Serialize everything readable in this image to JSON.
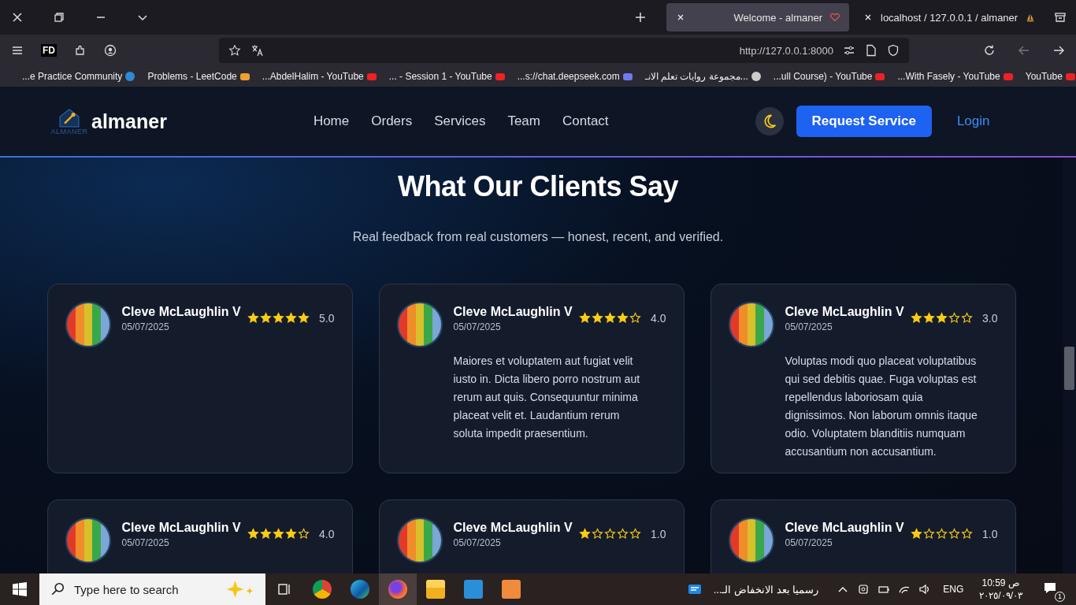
{
  "browser": {
    "tabs": [
      {
        "title": "Welcome - almaner",
        "selected": true
      },
      {
        "title": "localhost / 127.0.0.1 / almaner",
        "selected": false
      }
    ],
    "address": "http://127.0.0.1:8000",
    "toolbar_badge": "FD",
    "bookmarks": [
      {
        "label": "...e Practice Community"
      },
      {
        "label": "Problems - LeetCode"
      },
      {
        "label": "...AbdelHalim - YouTube"
      },
      {
        "label": "... - Session 1 - YouTube"
      },
      {
        "label": "...s://chat.deepseek.com"
      },
      {
        "label": "مجموعة روايات تعلم الانـ..."
      },
      {
        "label": "...ull Course) - YouTube"
      },
      {
        "label": "...With Fasely - YouTube"
      },
      {
        "label": "YouTube"
      }
    ]
  },
  "site": {
    "logo_caption": "ALMANER",
    "brand": "almaner",
    "nav": [
      {
        "label": "Home"
      },
      {
        "label": "Orders"
      },
      {
        "label": "Services"
      },
      {
        "label": "Team"
      },
      {
        "label": "Contact"
      }
    ],
    "cta": "Request Service",
    "login": "Login"
  },
  "section": {
    "title": "What Our Clients Say",
    "subtitle": "Real feedback from real customers — honest, recent, and verified."
  },
  "reviews": [
    {
      "name": "Cleve McLaughlin V",
      "date": "05/07/2025",
      "stars": 5,
      "rating": "5.0"
    },
    {
      "name": "Cleve McLaughlin V",
      "date": "05/07/2025",
      "stars": 4,
      "rating": "4.0",
      "text": "Maiores et voluptatem aut fugiat velit iusto in. Dicta libero porro nostrum aut rerum aut quis. Consequuntur minima placeat velit et. Laudantium rerum soluta impedit praesentium."
    },
    {
      "name": "Cleve McLaughlin V",
      "date": "05/07/2025",
      "stars": 3,
      "rating": "3.0",
      "text": "Voluptas modi quo placeat voluptatibus qui sed debitis quae. Fuga voluptas est repellendus laboriosam quia dignissimos. Non laborum omnis itaque odio. Voluptatem blanditiis numquam accusantium non accusantium."
    },
    {
      "name": "Cleve McLaughlin V",
      "date": "05/07/2025",
      "stars": 4,
      "rating": "4.0"
    },
    {
      "name": "Cleve McLaughlin V",
      "date": "05/07/2025",
      "stars": 1,
      "rating": "1.0"
    },
    {
      "name": "Cleve McLaughlin V",
      "date": "05/07/2025",
      "stars": 1,
      "rating": "1.0"
    }
  ],
  "taskbar": {
    "search": {
      "placeholder": "Type here to search"
    },
    "news": "رسميا بعد الانخفاض الـ...",
    "language": "ENG",
    "time": "10:59 ص",
    "date": "٢٠٢٥/٠٩/٠٣",
    "notifications": "1"
  }
}
